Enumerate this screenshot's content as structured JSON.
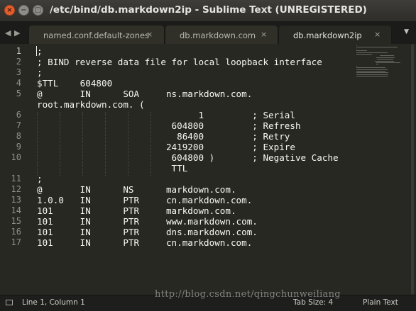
{
  "window": {
    "title": "/etc/bind/db.markdown2ip - Sublime Text (UNREGISTERED)",
    "close_glyph": "×",
    "minimize_glyph": "−",
    "maximize_glyph": "□"
  },
  "nav": {
    "back": "◀",
    "forward": "▶"
  },
  "tabs": [
    {
      "label": "named.conf.default-zones",
      "close": "×"
    },
    {
      "label": "db.markdown.com",
      "close": "×"
    },
    {
      "label": "db.markdown2ip",
      "close": "×"
    }
  ],
  "tab_menu_glyph": "▼",
  "editor": {
    "line_numbers": [
      "1",
      "2",
      "3",
      "4",
      "5",
      "",
      "6",
      "7",
      "8",
      "9",
      "10",
      "",
      "11",
      "12",
      "13",
      "14",
      "15",
      "16",
      "17"
    ],
    "lines": [
      ";",
      "; BIND reverse data file for local loopback interface",
      ";",
      "$TTL    604800",
      "@       IN      SOA     ns.markdown.com.",
      "root.markdown.com. (",
      "                              1         ; Serial",
      "                         604800         ; Refresh",
      "                          86400         ; Retry",
      "                        2419200         ; Expire",
      "                         604800 )       ; Negative Cache",
      "                         TTL",
      ";",
      "@       IN      NS      markdown.com.",
      "1.0.0   IN      PTR     cn.markdown.com.",
      "101     IN      PTR     markdown.com.",
      "101     IN      PTR     www.markdown.com.",
      "101     IN      PTR     dns.markdown.com.",
      "101     IN      PTR     cn.markdown.com."
    ]
  },
  "status": {
    "position": "Line 1, Column 1",
    "tab_size": "Tab Size: 4",
    "syntax": "Plain Text"
  },
  "watermark": "http://blog.csdn.net/qingchunweiliang"
}
